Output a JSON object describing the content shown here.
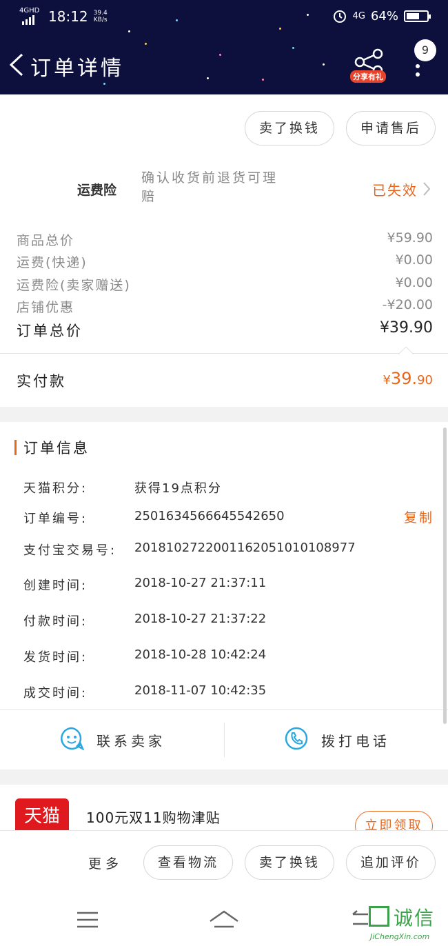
{
  "status_bar": {
    "network": "4GHD",
    "time": "18:12",
    "speed_value": "39.4",
    "speed_unit": "KB/s",
    "network2": "4G",
    "battery": "64%",
    "battery_level": 0.64
  },
  "header": {
    "title": "订单详情",
    "share_label": "分享有礼",
    "badge_count": "9"
  },
  "top_actions": {
    "sell_label": "卖了换钱",
    "after_sale_label": "申请售后"
  },
  "insurance": {
    "label": "运费险",
    "desc": "确认收货前退货可理赔",
    "status": "已失效"
  },
  "price_rows": [
    {
      "label": "商品总价",
      "value": "¥59.90"
    },
    {
      "label": "运费(快递)",
      "value": "¥0.00"
    },
    {
      "label": "运费险(卖家赠送)",
      "value": "¥0.00"
    },
    {
      "label": "店铺优惠",
      "value": "-¥20.00"
    }
  ],
  "order_total": {
    "label": "订单总价",
    "value": "¥39.90"
  },
  "paid": {
    "label": "实付款",
    "currency": "¥",
    "int": "39.",
    "dec": "90"
  },
  "order_info": {
    "heading": "订单信息",
    "rows": [
      {
        "label": "天猫积分:",
        "value": "获得19点积分"
      },
      {
        "label": "订单编号:",
        "value": "2501634566645542650"
      },
      {
        "label": "支付宝交易号:",
        "value": "2018102722001162051010108977"
      },
      {
        "label": "创建时间:",
        "value": "2018-10-27 21:37:11"
      },
      {
        "label": "付款时间:",
        "value": "2018-10-27 21:37:22"
      },
      {
        "label": "发货时间:",
        "value": "2018-10-28 10:42:24"
      },
      {
        "label": "成交时间:",
        "value": "2018-11-07 10:42:35"
      }
    ],
    "copy_label": "复制"
  },
  "contact": {
    "seller_label": "联系卖家",
    "call_label": "拨打电话"
  },
  "promo": {
    "logo_text": "天猫",
    "title": "100元双11购物津贴",
    "claim_label": "立即领取"
  },
  "bottom_bar": {
    "more_label": "更多",
    "logistics_label": "查看物流",
    "sell_label": "卖了换钱",
    "review_label": "追加评价"
  },
  "watermark": {
    "text": "诚信",
    "url": "JiChengXin.com"
  },
  "colors": {
    "header_bg": "#0d0f3d",
    "accent": "#e8661a"
  }
}
